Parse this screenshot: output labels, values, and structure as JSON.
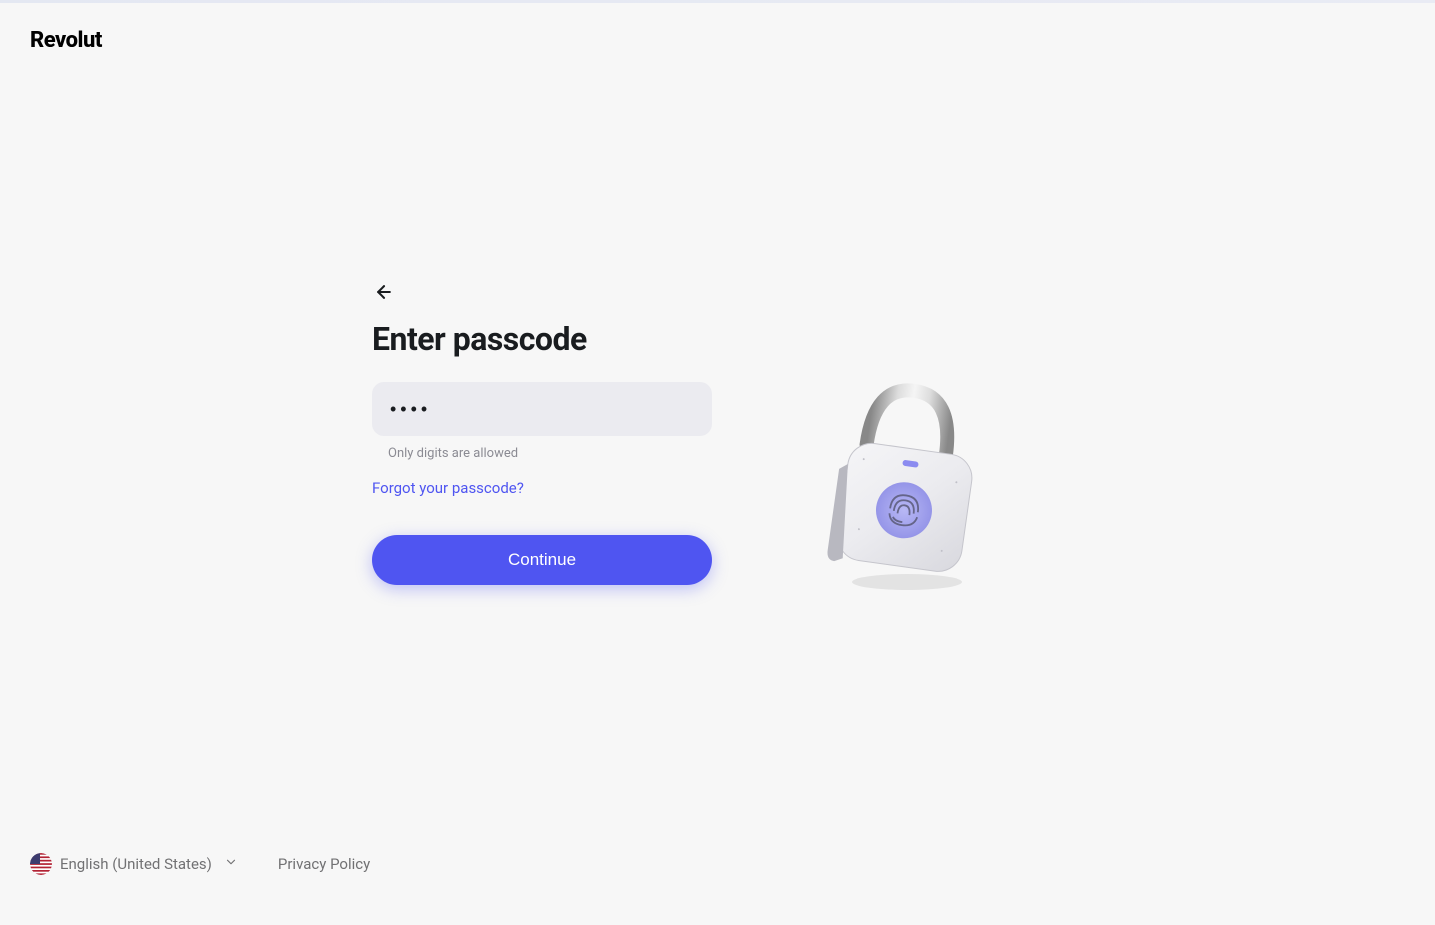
{
  "brand": "Revolut",
  "form": {
    "title": "Enter passcode",
    "passcode_value": "••••",
    "hint": "Only digits are allowed",
    "forgot_link": "Forgot your passcode?",
    "continue_label": "Continue"
  },
  "footer": {
    "language": "English (United States)",
    "privacy": "Privacy Policy"
  }
}
